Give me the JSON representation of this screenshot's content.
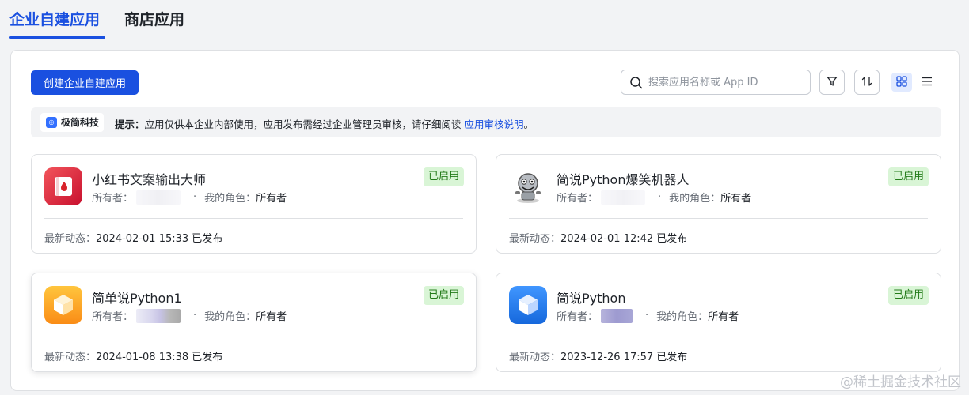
{
  "tabs": [
    {
      "label": "企业自建应用",
      "active": true
    },
    {
      "label": "商店应用",
      "active": false
    }
  ],
  "toolbar": {
    "create_label": "创建企业自建应用",
    "search_placeholder": "搜索应用名称或 App ID",
    "filter_icon": "filter-icon",
    "sort_icon": "sort-icon",
    "grid_view_icon": "grid-view-icon",
    "list_view_icon": "list-view-icon"
  },
  "notice": {
    "org_name": "极简科技",
    "prefix": "提示：",
    "text": "应用仅供本企业内部使用，应用发布需经过企业管理员审核，请仔细阅读 ",
    "link": "应用审核说明",
    "suffix": "。"
  },
  "apps": [
    {
      "name": "小红书文案输出大师",
      "owner_label": "所有者：",
      "role_label": "我的角色：",
      "role_value": "所有者",
      "status": "已启用",
      "latest_label": "最新动态：",
      "latest_value": "2024-02-01 15:33 已发布",
      "icon": "red-book-app-icon"
    },
    {
      "name": "简说Python爆笑机器人",
      "owner_label": "所有者：",
      "role_label": "我的角色：",
      "role_value": "所有者",
      "status": "已启用",
      "latest_label": "最新动态：",
      "latest_value": "2024-02-01 12:42 已发布",
      "icon": "robot-avatar-icon"
    },
    {
      "name": "简单说Python1",
      "owner_label": "所有者：",
      "role_label": "我的角色：",
      "role_value": "所有者",
      "status": "已启用",
      "latest_label": "最新动态：",
      "latest_value": "2024-01-08 13:38 已发布",
      "icon": "orange-cube-icon"
    },
    {
      "name": "简说Python",
      "owner_label": "所有者：",
      "role_label": "我的角色：",
      "role_value": "所有者",
      "status": "已启用",
      "latest_label": "最新动态：",
      "latest_value": "2023-12-26 17:57 已发布",
      "icon": "blue-cube-icon"
    }
  ],
  "watermark": "@稀土掘金技术社区",
  "colors": {
    "primary": "#1a50e0",
    "status_bg": "#d9f5d6",
    "status_text": "#237b19"
  }
}
